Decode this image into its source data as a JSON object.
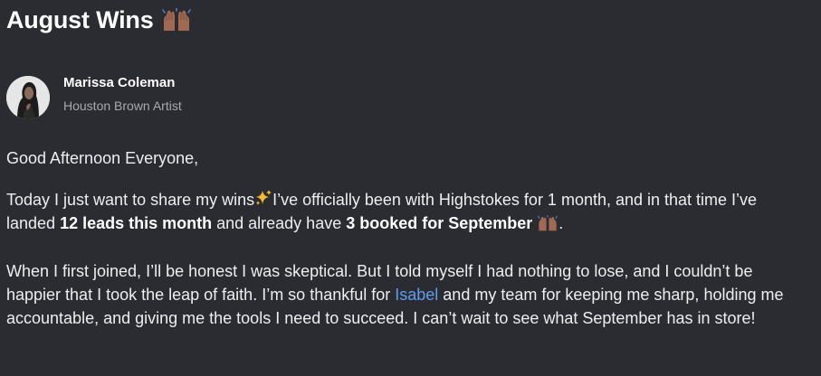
{
  "post": {
    "title": "August Wins",
    "title_emoji": "raising-hands-icon",
    "author": {
      "name": "Marissa Coleman",
      "role": "Houston Brown Artist",
      "avatar": "avatar"
    },
    "greeting": "Good Afternoon Everyone,",
    "wins_paragraph": {
      "part1": "Today I just want to share my wins",
      "sparkle": "sparkles-icon",
      "part2": "I’ve officially been with Highstokes for 1 month, and in that time I’ve landed ",
      "bold1": "12 leads this month",
      "part3": " and already have ",
      "bold2": "3 booked for September",
      "part4": ".",
      "end_emoji": "raising-hands-icon"
    },
    "story_paragraph": {
      "part1": "When I first joined, I’ll be honest I was skeptical. But I told myself I had nothing to lose, and I couldn’t be happier that I took the leap of faith. I’m so thankful for ",
      "mention": "Isabel",
      "part2": " and my team for keeping me sharp, holding me accountable, and giving me the tools I need to succeed. I can’t wait to see what September has in store!"
    }
  },
  "colors": {
    "background": "#2b2c32",
    "text": "#eeeef0",
    "muted": "#a8a9b0",
    "mention": "#5f9cf0"
  }
}
